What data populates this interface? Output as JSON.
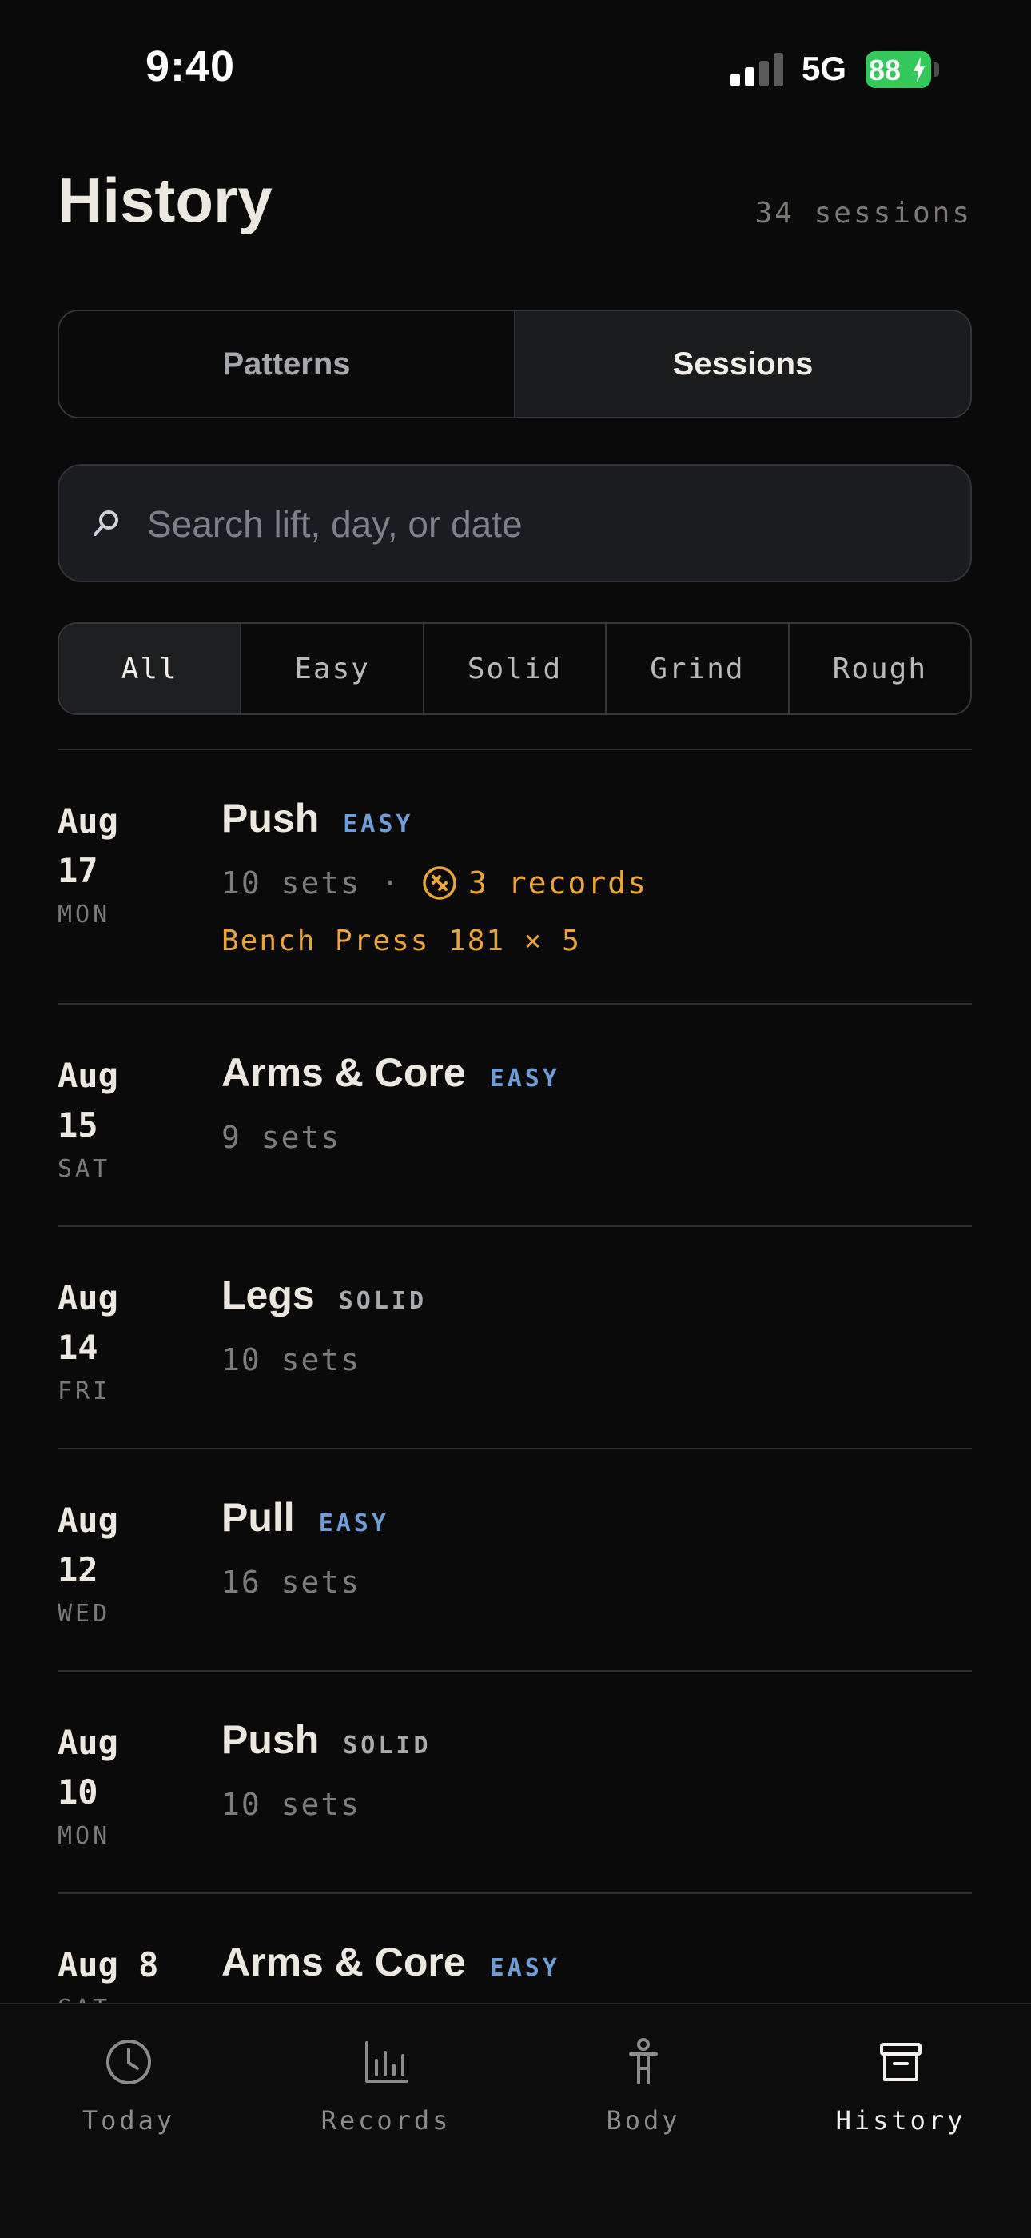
{
  "status_bar": {
    "time": "9:40",
    "network": "5G",
    "battery": "88"
  },
  "header": {
    "title": "History",
    "session_count": "34 sessions"
  },
  "segments": [
    {
      "label": "Patterns",
      "active": false
    },
    {
      "label": "Sessions",
      "active": true
    }
  ],
  "search": {
    "placeholder": "Search lift, day, or date",
    "value": ""
  },
  "filters": [
    {
      "label": "All",
      "active": true
    },
    {
      "label": "Easy",
      "active": false
    },
    {
      "label": "Solid",
      "active": false
    },
    {
      "label": "Grind",
      "active": false
    },
    {
      "label": "Rough",
      "active": false
    }
  ],
  "sessions": [
    {
      "month_day": "Aug 17",
      "weekday": "MON",
      "name": "Push",
      "tag": "EASY",
      "sets": "10 sets",
      "separator": "·",
      "records": "3 records",
      "highlight": "Bench Press 181 × 5"
    },
    {
      "month_day": "Aug 15",
      "weekday": "SAT",
      "name": "Arms & Core",
      "tag": "EASY",
      "sets": "9 sets"
    },
    {
      "month_day": "Aug 14",
      "weekday": "FRI",
      "name": "Legs",
      "tag": "SOLID",
      "sets": "10 sets"
    },
    {
      "month_day": "Aug 12",
      "weekday": "WED",
      "name": "Pull",
      "tag": "EASY",
      "sets": "16 sets"
    },
    {
      "month_day": "Aug 10",
      "weekday": "MON",
      "name": "Push",
      "tag": "SOLID",
      "sets": "10 sets"
    },
    {
      "month_day": "Aug 8",
      "weekday": "SAT",
      "name": "Arms & Core",
      "tag": "EASY",
      "sets": ""
    }
  ],
  "tabbar": [
    {
      "label": "Today",
      "icon": "clock-icon",
      "active": false
    },
    {
      "label": "Records",
      "icon": "bar-chart-icon",
      "active": false
    },
    {
      "label": "Body",
      "icon": "body-icon",
      "active": false
    },
    {
      "label": "History",
      "icon": "archive-icon",
      "active": true
    }
  ],
  "colors": {
    "background": "#0a0a0a",
    "easy": "#6d9ed8",
    "solid": "#a9abad",
    "record": "#e9a53a",
    "battery": "#34c759"
  }
}
